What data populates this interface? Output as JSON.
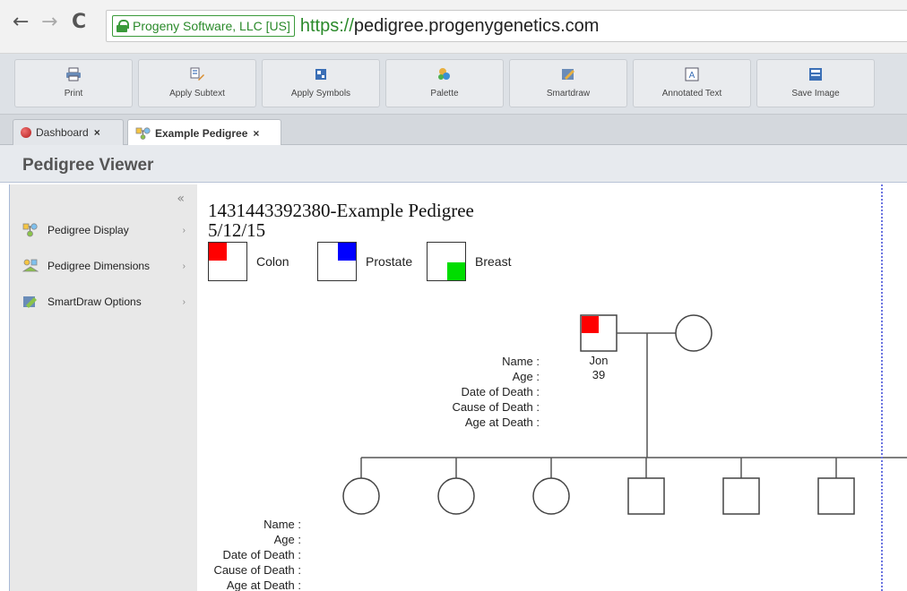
{
  "browser": {
    "secure_label": "Progeny Software, LLC [US]",
    "url_scheme": "https://",
    "url_host": "pedigree.progenygenetics.com"
  },
  "toolbar": {
    "buttons": [
      {
        "label": "Print",
        "icon": "printer-icon"
      },
      {
        "label": "Apply Subtext",
        "icon": "subtext-icon"
      },
      {
        "label": "Apply Symbols",
        "icon": "symbols-icon"
      },
      {
        "label": "Palette",
        "icon": "palette-icon"
      },
      {
        "label": "Smartdraw",
        "icon": "smartdraw-icon"
      },
      {
        "label": "Annotated Text",
        "icon": "annotated-text-icon"
      },
      {
        "label": "Save Image",
        "icon": "save-image-icon"
      }
    ]
  },
  "tabs": [
    {
      "label": "Dashboard",
      "close": "×",
      "active": false
    },
    {
      "label": "Example Pedigree",
      "close": "×",
      "active": true
    }
  ],
  "panel": {
    "title": "Pedigree Viewer",
    "collapse": "«"
  },
  "sidebar": {
    "items": [
      {
        "label": "Pedigree Display",
        "arrow": "›"
      },
      {
        "label": "Pedigree Dimensions",
        "arrow": "›"
      },
      {
        "label": "SmartDraw Options",
        "arrow": "›"
      }
    ]
  },
  "pedigree": {
    "title": "1431443392380-Example Pedigree",
    "date": "5/12/15",
    "legend": [
      {
        "label": "Colon",
        "color": "#ff0000",
        "quadrant": "top-left"
      },
      {
        "label": "Prostate",
        "color": "#0000ff",
        "quadrant": "top-right"
      },
      {
        "label": "Breast",
        "color": "#00dd00",
        "quadrant": "bottom-right"
      }
    ],
    "info_fields": [
      "Name :",
      "Age :",
      "Date of Death :",
      "Cause of Death :",
      "Age at Death :"
    ],
    "proband": {
      "name": "Jon",
      "age": "39"
    }
  }
}
